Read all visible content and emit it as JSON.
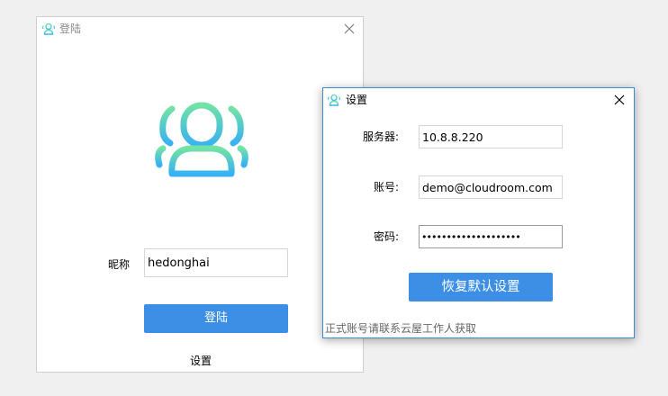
{
  "login_window": {
    "title": "登陆",
    "icon": "users-icon",
    "nickname_label": "昵称",
    "nickname_value": "hedonghai",
    "login_button": "登陆",
    "settings_link": "设置"
  },
  "settings_window": {
    "title": "设置",
    "icon": "users-icon",
    "fields": [
      {
        "label": "服务器:",
        "value": "10.8.8.220"
      },
      {
        "label": "账号:",
        "value": "demo@cloudroom.com"
      },
      {
        "label": "密码:",
        "value": "••••••••••••••••••••"
      }
    ],
    "reset_button": "恢复默认设置",
    "footer_note": "正式账号请联系云屋工作人获取"
  },
  "colors": {
    "accent": "#3d8fe6",
    "logo_gradient_top": "#6fe0a8",
    "logo_gradient_bottom": "#3ab4f2",
    "window_border_active": "#3f8ad0",
    "desktop_bg": "#f0f0f0"
  }
}
